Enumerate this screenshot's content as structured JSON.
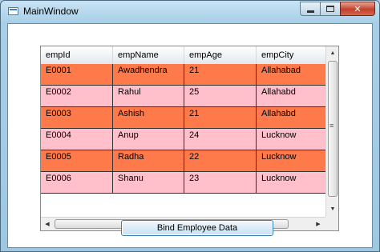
{
  "window": {
    "title": "MainWindow",
    "controls": {
      "minimize": "—",
      "maximize": "□",
      "close": "✕"
    }
  },
  "grid": {
    "columns": [
      "empId",
      "empName",
      "empAge",
      "empCity"
    ],
    "rows": [
      {
        "empId": "E0001",
        "empName": "Awadhendra",
        "empAge": "21",
        "empCity": "Allahabad",
        "color": "#ff7a4a"
      },
      {
        "empId": "E0002",
        "empName": "Rahul",
        "empAge": "25",
        "empCity": "Allahabd",
        "color": "#ffc0cb"
      },
      {
        "empId": "E0003",
        "empName": "Ashish",
        "empAge": "21",
        "empCity": "Allahabd",
        "color": "#ff7a4a"
      },
      {
        "empId": "E0004",
        "empName": "Anup",
        "empAge": "24",
        "empCity": "Lucknow",
        "color": "#ffc0cb"
      },
      {
        "empId": "E0005",
        "empName": "Radha",
        "empAge": "22",
        "empCity": "Lucknow",
        "color": "#ff7a4a"
      },
      {
        "empId": "E0006",
        "empName": "Shanu",
        "empAge": "23",
        "empCity": "Lucknow",
        "color": "#ffc0cb"
      }
    ],
    "scrollbar": {
      "up": "▲",
      "down": "▼",
      "left": "◀",
      "right": "▶",
      "grip": "≡",
      "hgrip": "|||"
    }
  },
  "actions": {
    "bind_label": "Bind Employee Data"
  }
}
